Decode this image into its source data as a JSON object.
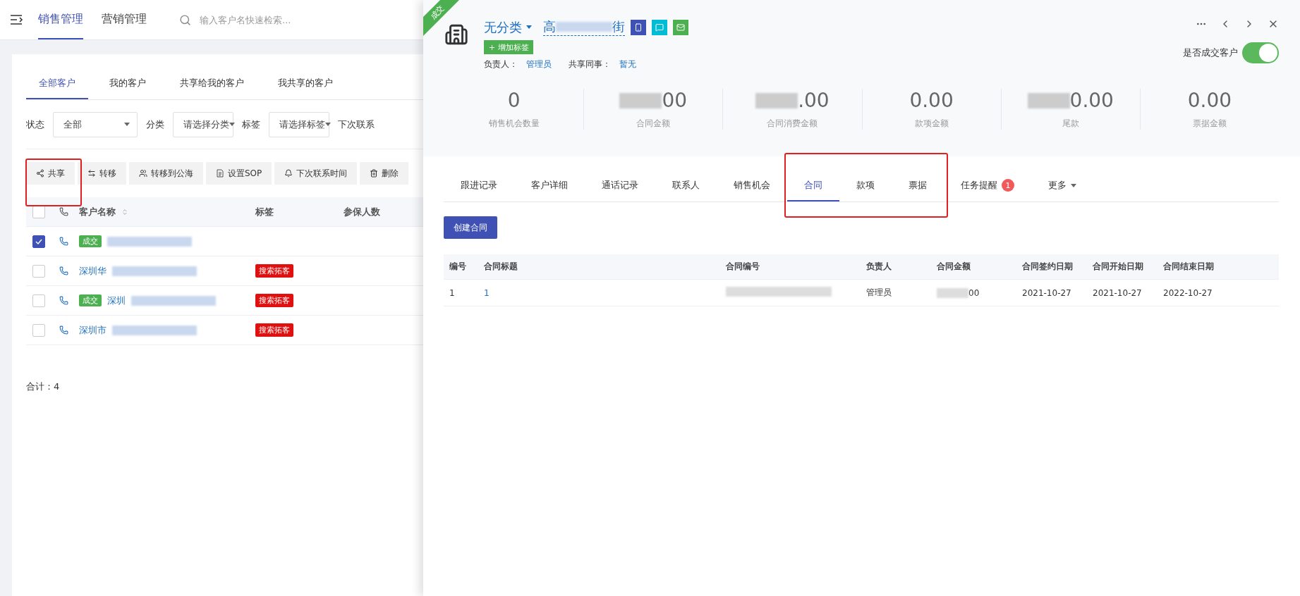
{
  "top_bar": {
    "tabs": [
      {
        "label": "销售管理",
        "selected": true
      },
      {
        "label": "营销管理",
        "selected": false
      }
    ],
    "search": {
      "placeholder": "输入客户名快速检索..."
    }
  },
  "customer_tabs": [
    {
      "label": "全部客户",
      "selected": true
    },
    {
      "label": "我的客户",
      "selected": false
    },
    {
      "label": "共享给我的客户",
      "selected": false
    },
    {
      "label": "我共享的客户",
      "selected": false
    }
  ],
  "filters": [
    {
      "label": "状态",
      "value": "全部",
      "kind": "wide"
    },
    {
      "label": "分类",
      "value": "请选择分类",
      "kind": "narrow"
    },
    {
      "label": "标签",
      "value": "请选择标签",
      "kind": "narrow"
    },
    {
      "label": "下次联系",
      "kind": "label_only"
    }
  ],
  "actions": [
    {
      "label": "共享"
    },
    {
      "label": "转移"
    },
    {
      "label": "转移到公海"
    },
    {
      "label": "设置SOP"
    },
    {
      "label": "下次联系时间"
    },
    {
      "label": "删除"
    }
  ],
  "customer_table": {
    "select_all": {
      "checked": false
    },
    "columns": [
      "客户名称",
      "标签",
      "参保人数"
    ],
    "rows": [
      {
        "checked": true,
        "deal_label": "成交",
        "name": "",
        "tag": ""
      },
      {
        "checked": false,
        "name": "深圳华",
        "tag": "搜索拓客"
      },
      {
        "checked": false,
        "deal_label": "成交",
        "name": "深圳",
        "tag": "搜索拓客"
      },
      {
        "checked": false,
        "name": "深圳市",
        "tag": "搜索拓客"
      }
    ]
  },
  "total": "合计：4",
  "drawer": {
    "corner_badge": "成交",
    "category": "无分类",
    "name_start": "高",
    "name_end": "街",
    "add_tag": "增加标签",
    "owner_label": "负责人：",
    "owner": "管理员",
    "colleague_label": "共享同事：",
    "colleague": "暂无",
    "deal_toggle": {
      "label": "是否成交客户",
      "on": true
    },
    "stats": [
      {
        "value": "0",
        "label": "销售机会数量",
        "redacted": false
      },
      {
        "value": "00",
        "label": "合同金额",
        "redacted": true
      },
      {
        "value": ".00",
        "label": "合同消费金额",
        "redacted": true
      },
      {
        "value": "0.00",
        "label": "款项金额",
        "redacted": false
      },
      {
        "value": "0.00",
        "label": "尾款",
        "redacted": true
      },
      {
        "value": "0.00",
        "label": "票据金额",
        "redacted": false
      }
    ],
    "tabs": [
      {
        "label": "跟进记录",
        "selected": false
      },
      {
        "label": "客户详细",
        "selected": false
      },
      {
        "label": "通话记录",
        "selected": false
      },
      {
        "label": "联系人",
        "selected": false
      },
      {
        "label": "销售机会",
        "selected": false
      },
      {
        "label": "合同",
        "selected": true
      },
      {
        "label": "款项",
        "selected": false
      },
      {
        "label": "票据",
        "selected": false
      },
      {
        "label": "任务提醒",
        "selected": false,
        "badge": "1"
      },
      {
        "label": "更多",
        "selected": false,
        "dropdown": true
      }
    ],
    "create_button": "创建合同",
    "contract_table": {
      "columns": [
        "编号",
        "合同标题",
        "合同编号",
        "负责人",
        "合同金额",
        "合同签约日期",
        "合同开始日期",
        "合同结束日期"
      ],
      "rows": [
        {
          "cells": [
            "1",
            "1",
            "",
            "管理员",
            "00",
            "2021-10-27",
            "2021-10-27",
            "2022-10-27"
          ]
        }
      ]
    }
  }
}
